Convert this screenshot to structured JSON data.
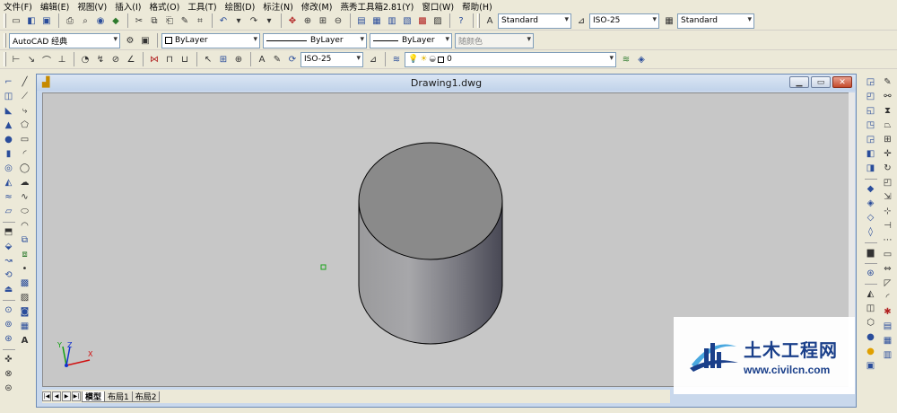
{
  "menu": [
    "文件(F)",
    "编辑(E)",
    "视图(V)",
    "插入(I)",
    "格式(O)",
    "工具(T)",
    "绘图(D)",
    "标注(N)",
    "修改(M)",
    "燕秀工具箱2.81(Y)",
    "窗口(W)",
    "帮助(H)"
  ],
  "styles": {
    "text_style": "Standard",
    "dim_style": "ISO-25",
    "table_style": "Standard"
  },
  "properties": {
    "workspace": "AutoCAD 经典",
    "color": "ByLayer",
    "linetype": "ByLayer",
    "lineweight": "ByLayer",
    "plotstyle": "随颜色"
  },
  "dimension": {
    "style": "ISO-25"
  },
  "layer": {
    "current": "0"
  },
  "window": {
    "title": "Drawing1.dwg"
  },
  "tabs": [
    "模型",
    "布局1",
    "布局2"
  ],
  "active_tab": 0,
  "ucs": {
    "x_label": "X",
    "y_label": "Y",
    "z_label": "Z"
  },
  "watermark": {
    "brand": "土木工程网",
    "url": "www.civilcn.com"
  },
  "colors": {
    "canvas_bg": "#c7c7c7",
    "cylinder_top": "#8a8a8a",
    "cylinder_side_light": "#a9a9ab",
    "cylinder_side_dark": "#454550",
    "brand_blue": "#1a3f8a"
  }
}
